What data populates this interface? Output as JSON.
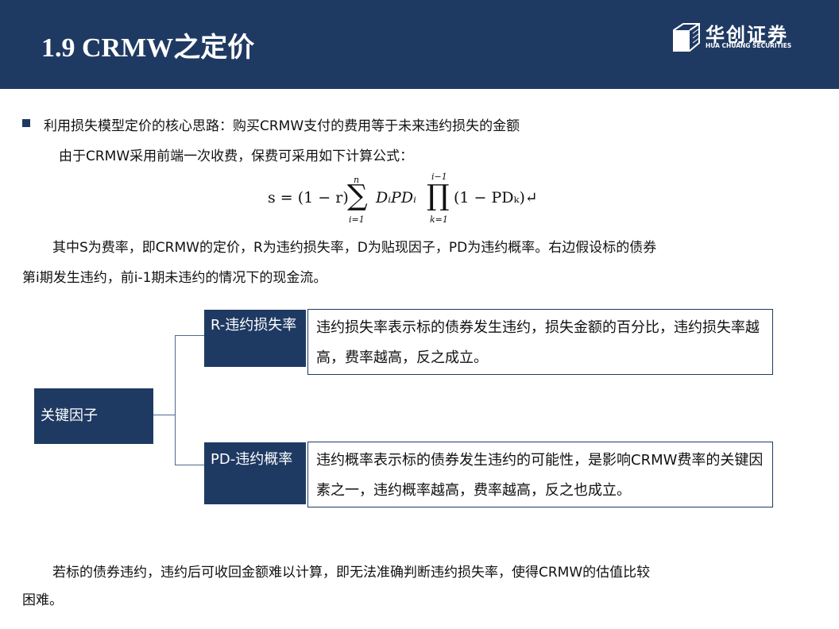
{
  "header": {
    "title": "1.9 CRMW之定价",
    "logo_cn": "华创证券",
    "logo_en": "HUA CHUANG SECURITIES"
  },
  "body": {
    "bullet": "利用损失模型定价的核心思路：购买CRMW支付的费用等于未来违约损失的金额",
    "line2": "由于CRMW采用前端一次收费，保费可采用如下计算公式：",
    "formula": {
      "lhs": "s = (1 − r)",
      "sum": "∑",
      "sum_top": "n",
      "sum_bot": "i=1",
      "term": "DᵢPDᵢ",
      "prod": "∏",
      "prod_top": "i−1",
      "prod_bot": "k=1",
      "tail": "(1 − PDₖ)↵"
    },
    "para1_line1": "其中S为费率，即CRMW的定价，R为违约损失率，D为贴现因子，PD为违约概率。右边假设标的债券",
    "para1_line2": "第i期发生违约，前i-1期未违约的情况下的现金流。",
    "para2_line1": "若标的债券违约，违约后可收回金额难以计算，即无法准确判断违约损失率，使得CRMW的估值比较",
    "para2_line2": "困难。"
  },
  "diagram": {
    "root": "关键因子",
    "branches": [
      {
        "label": "R-违约损失率",
        "desc": "违约损失率表示标的债券发生违约，损失金额的百分比，违约损失率越高，费率越高，反之成立。"
      },
      {
        "label": "PD-违约概率",
        "desc": "违约概率表示标的债券发生违约的可能性，是影响CRMW费率的关键因素之一，违约概率越高，费率越高，反之也成立。"
      }
    ]
  }
}
